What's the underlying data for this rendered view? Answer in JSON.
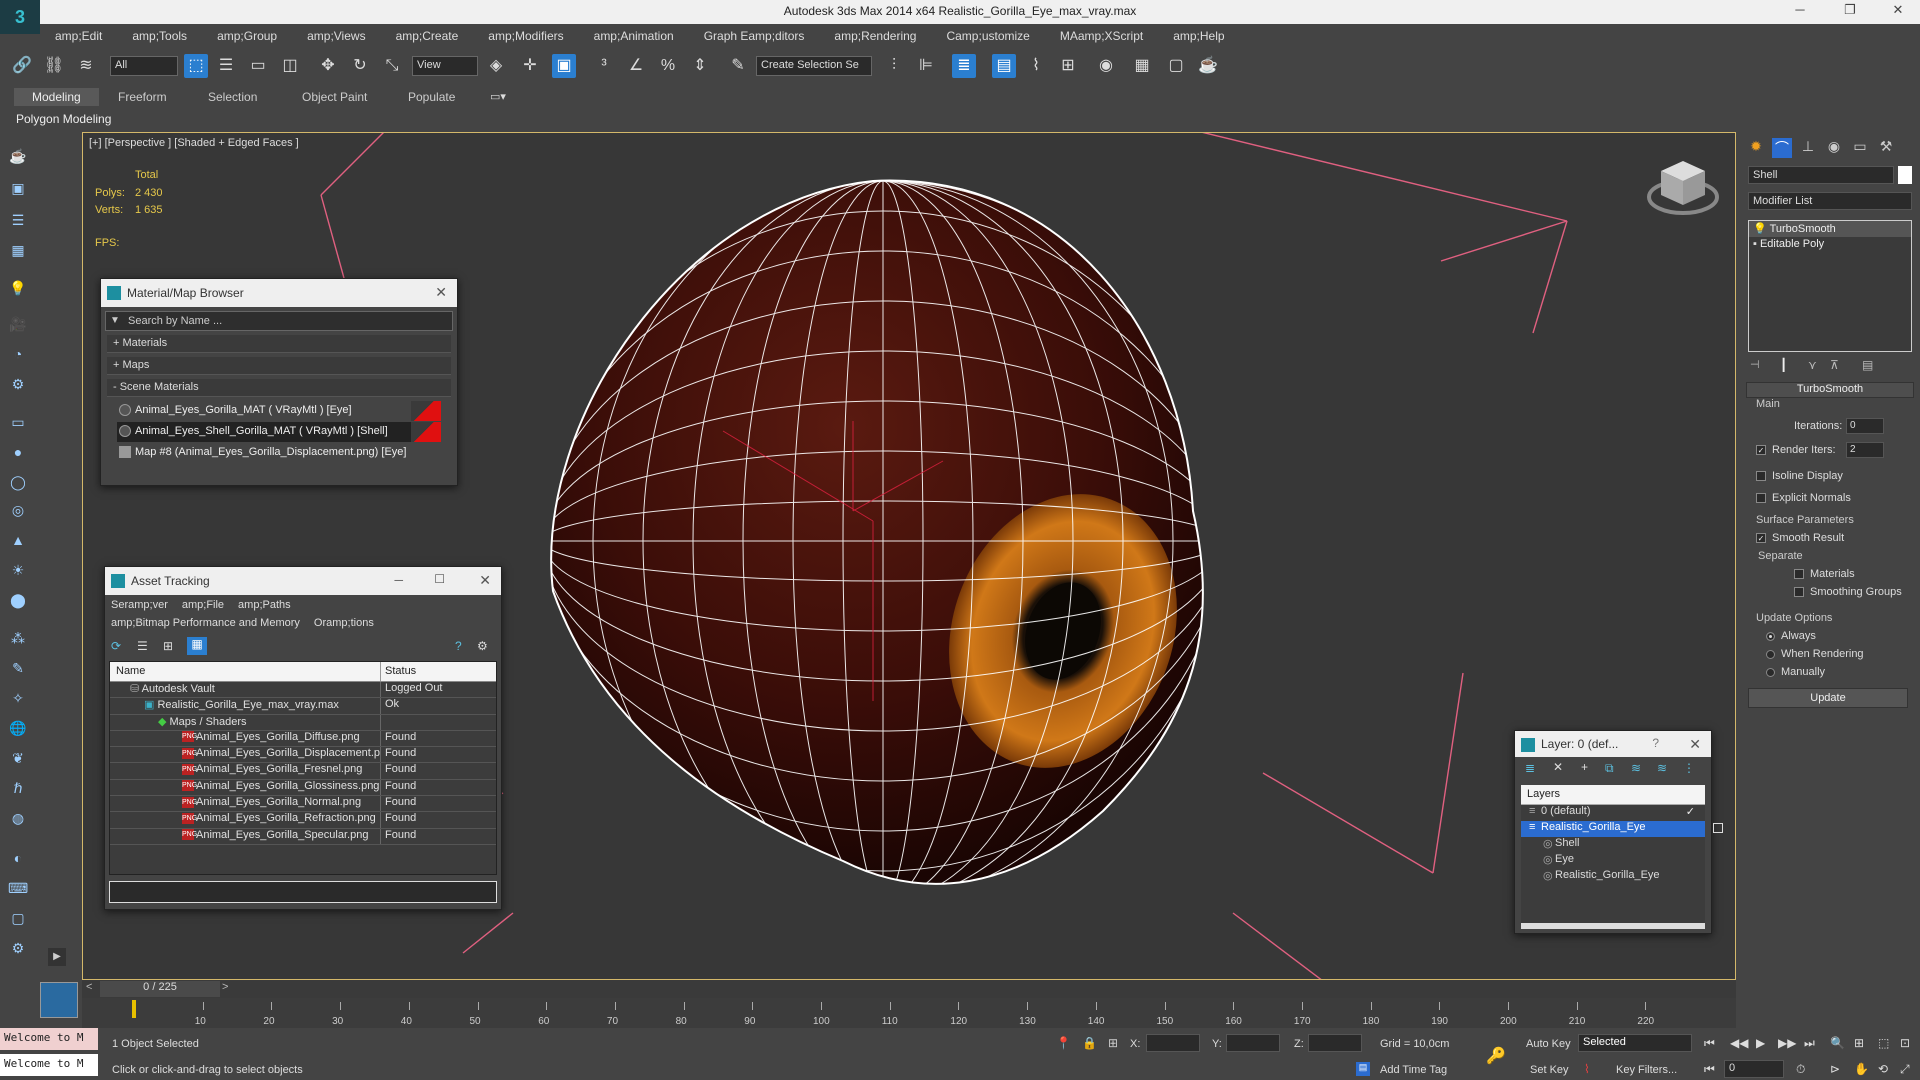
{
  "window": {
    "title": "Autodesk 3ds Max  2014 x64     Realistic_Gorilla_Eye_max_vray.max",
    "logo_text": "3",
    "controls": [
      "─",
      "❐",
      "✕"
    ]
  },
  "menu": [
    "amp;Edit",
    "amp;Tools",
    "amp;Group",
    "amp;Views",
    "amp;Create",
    "amp;Modifiers",
    "amp;Animation",
    "Graph Eamp;ditors",
    "amp;Rendering",
    "Camp;ustomize",
    "MAamp;XScript",
    "amp;Help"
  ],
  "toolbar": {
    "selection_filter": "All",
    "ref_coord": "View",
    "named_selection": "Create Selection Se"
  },
  "ribbon": {
    "tabs": [
      "Modeling",
      "Freeform",
      "Selection",
      "Object Paint",
      "Populate"
    ],
    "active_tab": "Modeling",
    "sub_label": "Polygon Modeling"
  },
  "viewport": {
    "label": "[+] [Perspective ] [Shaded + Edged Faces ]",
    "stats_header": "Total",
    "polys_label": "Polys:",
    "polys_value": "2 430",
    "verts_label": "Verts:",
    "verts_value": "1 635",
    "fps_label": "FPS:"
  },
  "material_browser": {
    "title": "Material/Map Browser",
    "search_placeholder": "Search by Name ...",
    "sections": [
      "+ Materials",
      "+ Maps",
      "- Scene Materials"
    ],
    "items": [
      "Animal_Eyes_Gorilla_MAT  ( VRayMtl ) [Eye]",
      "Animal_Eyes_Shell_Gorilla_MAT  ( VRayMtl ) [Shell]",
      "Map #8 (Animal_Eyes_Gorilla_Displacement.png) [Eye]"
    ]
  },
  "asset_tracking": {
    "title": "Asset Tracking",
    "menu_row1": [
      "Seramp;ver",
      "amp;File",
      "amp;Paths"
    ],
    "menu_row2": [
      "amp;Bitmap Performance and Memory",
      "Oramp;tions"
    ],
    "col_name": "Name",
    "col_status": "Status",
    "rows": [
      {
        "name": "Autodesk Vault",
        "status": "Logged Out"
      },
      {
        "name": "Realistic_Gorilla_Eye_max_vray.max",
        "status": "Ok"
      },
      {
        "name": "Maps / Shaders",
        "status": ""
      },
      {
        "name": "Animal_Eyes_Gorilla_Diffuse.png",
        "status": "Found"
      },
      {
        "name": "Animal_Eyes_Gorilla_Displacement.png",
        "status": "Found"
      },
      {
        "name": "Animal_Eyes_Gorilla_Fresnel.png",
        "status": "Found"
      },
      {
        "name": "Animal_Eyes_Gorilla_Glossiness.png",
        "status": "Found"
      },
      {
        "name": "Animal_Eyes_Gorilla_Normal.png",
        "status": "Found"
      },
      {
        "name": "Animal_Eyes_Gorilla_Refraction.png",
        "status": "Found"
      },
      {
        "name": "Animal_Eyes_Gorilla_Specular.png",
        "status": "Found"
      }
    ]
  },
  "layer_window": {
    "title": "Layer: 0 (def...",
    "help": "?",
    "header": "Layers",
    "rows": [
      "0 (default)",
      "Realistic_Gorilla_Eye",
      "Shell",
      "Eye",
      "Realistic_Gorilla_Eye"
    ]
  },
  "command_panel": {
    "object_name": "Shell",
    "modifier_list": "Modifier List",
    "stack": [
      "TurboSmooth",
      "Editable Poly"
    ],
    "rollout_title": "TurboSmooth",
    "main_label": "Main",
    "iterations_label": "Iterations:",
    "iterations_value": "0",
    "render_iters_label": "Render Iters:",
    "render_iters_value": "2",
    "isoline": "Isoline Display",
    "explicit_normals": "Explicit Normals",
    "surface_params": "Surface Parameters",
    "smooth_result": "Smooth Result",
    "separate": "Separate",
    "materials": "Materials",
    "smoothing_groups": "Smoothing Groups",
    "update_options": "Update Options",
    "always": "Always",
    "when_rendering": "When Rendering",
    "manually": "Manually",
    "update_button": "Update"
  },
  "timeline": {
    "frame_readout": "0 / 225",
    "ticks": [
      "10",
      "20",
      "30",
      "40",
      "50",
      "60",
      "70",
      "80",
      "90",
      "100",
      "110",
      "120",
      "130",
      "140",
      "150",
      "160",
      "170",
      "180",
      "190",
      "200",
      "210",
      "220"
    ]
  },
  "status": {
    "maxscript": "Welcome to M",
    "objects_selected": "1 Object Selected",
    "prompt": "Click or click-and-drag to select objects",
    "x_label": "X:",
    "y_label": "Y:",
    "z_label": "Z:",
    "grid": "Grid = 10,0cm",
    "add_time_tag": "Add Time Tag",
    "auto_key": "Auto Key",
    "set_key": "Set Key",
    "selected": "Selected",
    "key_filters": "Key Filters...",
    "frame": "0"
  }
}
